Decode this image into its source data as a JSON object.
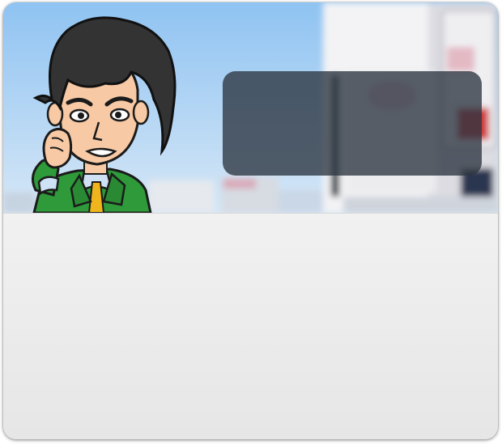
{
  "colors": {
    "sky": "#a9cdf0",
    "panel_background": "#ededed",
    "overlay_box": "#2b3540",
    "suit": "#2e9a3a",
    "hair": "#333333",
    "skin": "#f7c9a4",
    "tie": "#f0b51c"
  },
  "hero": {
    "illustration_icon": "cartoon-businessman-icon"
  }
}
